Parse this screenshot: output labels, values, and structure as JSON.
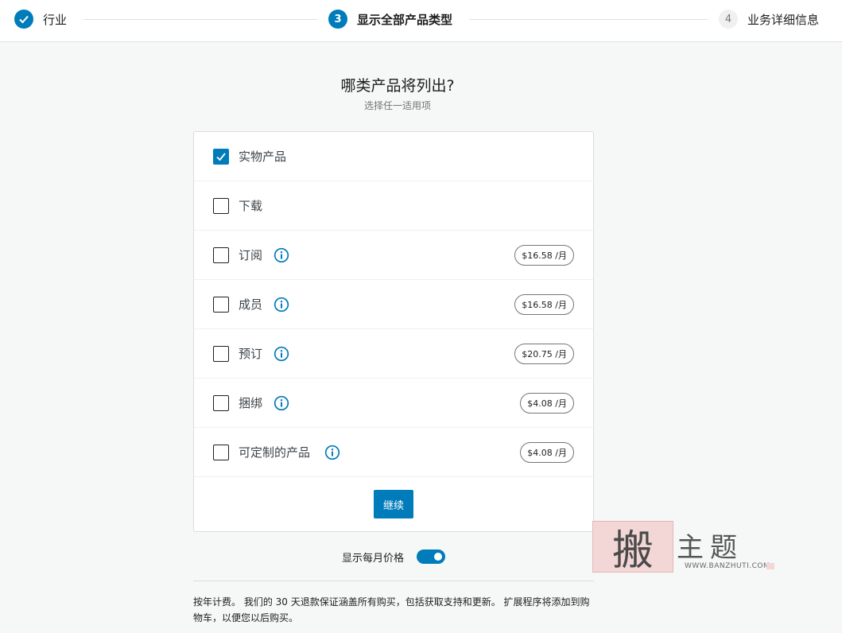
{
  "stepper": {
    "steps": [
      {
        "label": "行业",
        "state": "done"
      },
      {
        "number": "3",
        "label": "显示全部产品类型",
        "state": "active"
      },
      {
        "number": "4",
        "label": "业务详细信息",
        "state": "pending"
      }
    ]
  },
  "header": {
    "title": "哪类产品将列出?",
    "subtitle": "选择任一适用项"
  },
  "products": [
    {
      "label": "实物产品",
      "checked": true
    },
    {
      "label": "下载",
      "checked": false
    },
    {
      "label": "订阅",
      "checked": false,
      "price": "$16.58 /月"
    },
    {
      "label": "成员",
      "checked": false,
      "price": "$16.58 /月"
    },
    {
      "label": "预订",
      "checked": false,
      "price": "$20.75 /月"
    },
    {
      "label": "捆绑",
      "checked": false,
      "price": "$4.08 /月"
    },
    {
      "label": "可定制的产品",
      "checked": false,
      "price": "$4.08 /月"
    }
  ],
  "continue_label": "继续",
  "toggle": {
    "label": "显示每月价格",
    "on": true
  },
  "footnote": "按年计费。 我们的 30 天退款保证涵盖所有购买，包括获取支持和更新。 扩展程序将添加到购物车，以便您以后购买。",
  "watermark": {
    "text": "主题",
    "url": "WWW.BANZHUTI.COM"
  },
  "colors": {
    "accent": "#007cba",
    "background": "#f6f7f7"
  }
}
